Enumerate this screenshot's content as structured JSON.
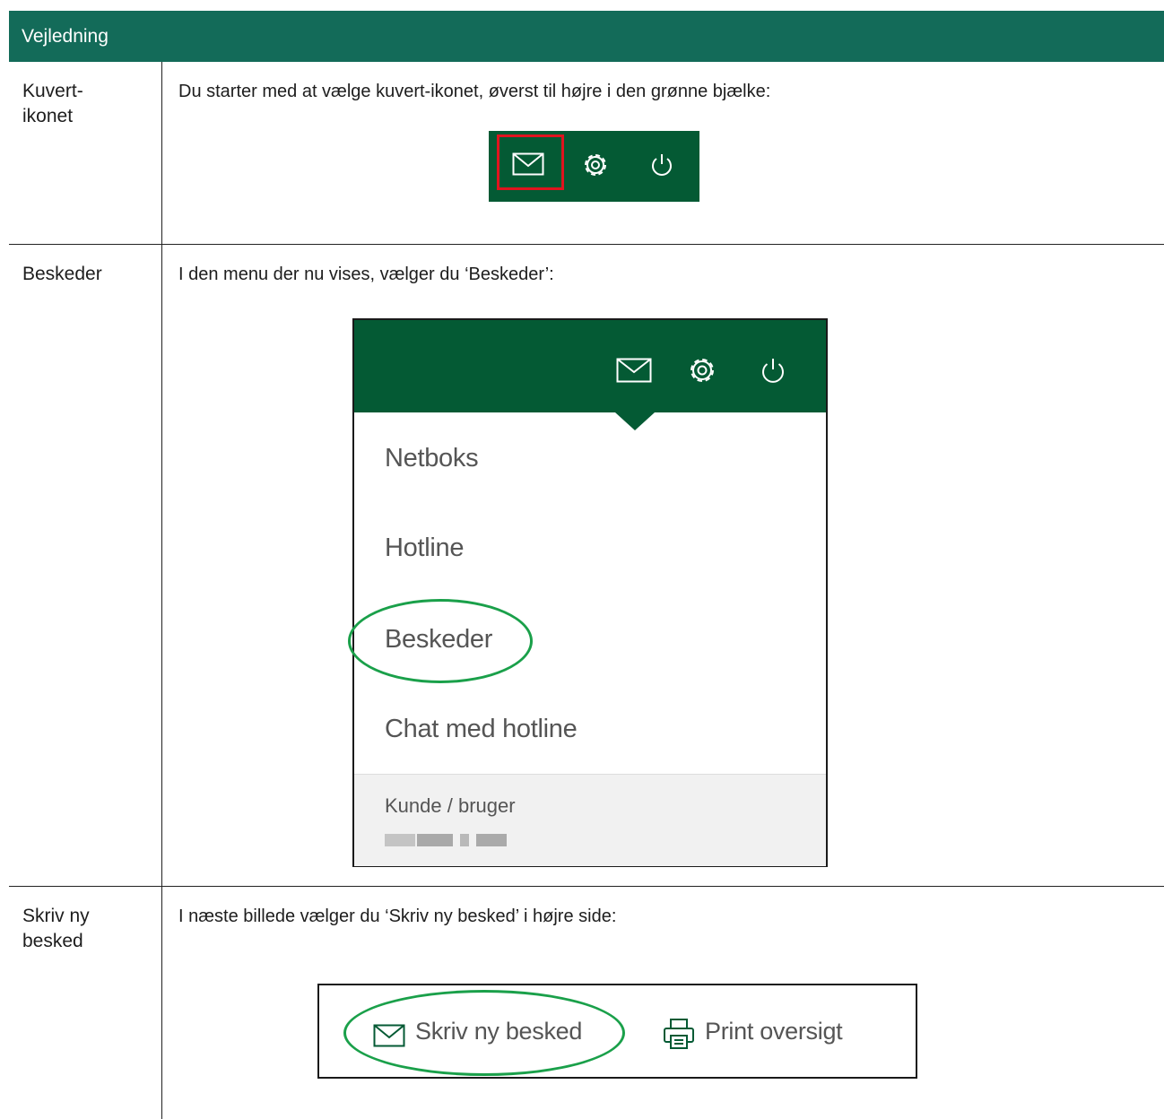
{
  "header": {
    "title": "Vejledning"
  },
  "rows": [
    {
      "label_lines": [
        "Kuvert-",
        "ikonet"
      ],
      "instruction": "Du starter med at vælge kuvert-ikonet, øverst til højre i den grønne bjælke:",
      "icons": [
        "envelope-icon",
        "gear-icon",
        "power-icon"
      ]
    },
    {
      "label_lines": [
        "Beskeder"
      ],
      "instruction": "I den menu der nu vises, vælger du ‘Beskeder’:",
      "icons": [
        "envelope-icon",
        "gear-icon",
        "power-icon"
      ],
      "menu_items": [
        "Netboks",
        "Hotline",
        "Beskeder",
        "Chat med hotline"
      ],
      "footer_label": "Kunde / bruger"
    },
    {
      "label_lines": [
        "Skriv ny",
        "besked"
      ],
      "instruction": "I næste billede vælger du ‘Skriv ny besked’ i højre side:",
      "actions": [
        {
          "icon": "envelope-icon",
          "label": "Skriv ny besked"
        },
        {
          "icon": "printer-icon",
          "label": "Print oversigt"
        }
      ]
    }
  ],
  "colors": {
    "header_bg": "#136b59",
    "toolbar_bg": "#045a34",
    "highlight_red": "#e0141e",
    "highlight_green": "#1aa04a"
  }
}
